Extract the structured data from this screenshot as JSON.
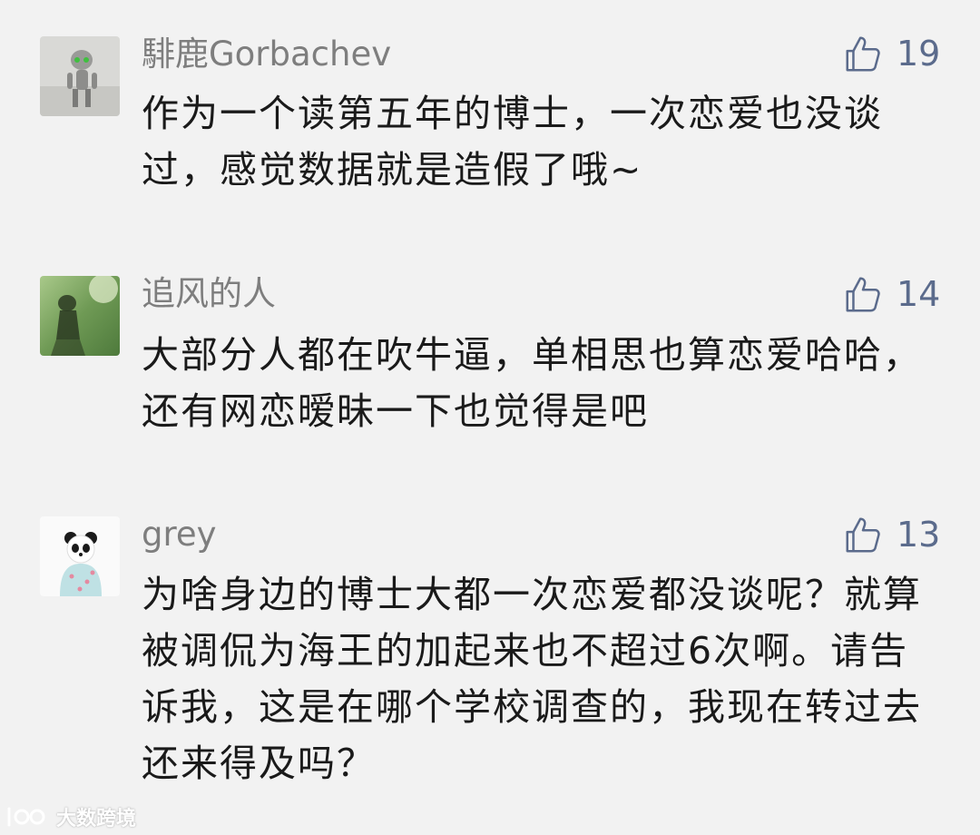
{
  "comments": [
    {
      "username": "騑鹿Gorbachev",
      "likes": "19",
      "text": "作为一个读第五年的博士，一次恋爱也没谈过，感觉数据就是造假了哦~",
      "avatar_icon": "robot-figure-avatar"
    },
    {
      "username": "追风的人",
      "likes": "14",
      "text": "大部分人都在吹牛逼，单相思也算恋爱哈哈，还有网恋暧昧一下也觉得是吧",
      "avatar_icon": "shadow-on-grass-avatar"
    },
    {
      "username": "grey",
      "likes": "13",
      "text": "为啥身边的博士大都一次恋爱都没谈呢？就算被调侃为海王的加起来也不超过6次啊。请告诉我，这是在哪个学校调查的，我现在转过去还来得及吗？",
      "avatar_icon": "panda-avatar"
    }
  ],
  "watermark": {
    "text": "大数跨境",
    "icon": "brand-logo-icon"
  },
  "colors": {
    "background": "#f2f2f2",
    "username": "#7e7e7e",
    "like": "#5b6b8c",
    "text": "#1a1a1a"
  }
}
